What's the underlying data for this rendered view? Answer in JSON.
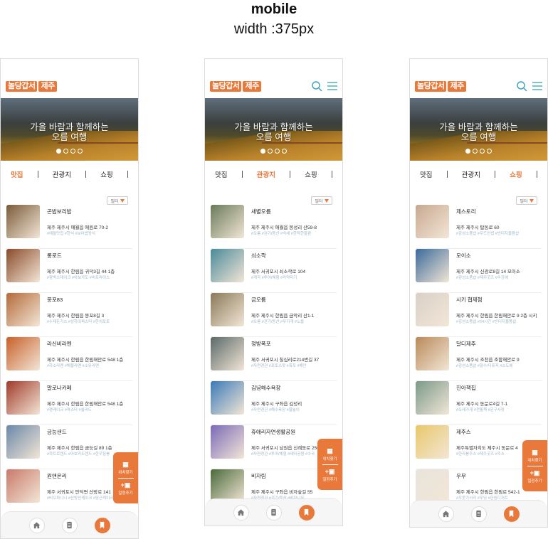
{
  "page": {
    "title": "mobile",
    "subtitle": "width :375px"
  },
  "brand": {
    "logo_part1": "놀당갑서",
    "logo_part2": "제주",
    "accent": "#e8793a",
    "tag_color": "#9ab8c8"
  },
  "hero": {
    "line1": "가을 바람과 함께하는",
    "line2": "오름 여행",
    "slides": 4,
    "active_slide": 0
  },
  "tabs": [
    "맛집",
    "관광지",
    "쇼핑"
  ],
  "filter_label": "필터",
  "float": {
    "location_label": "위치찾기",
    "schedule_label": "일정추가",
    "location_icon": "map-icon",
    "schedule_icon": "calendar-plus-icon"
  },
  "bottom_nav": [
    {
      "icon": "home-icon",
      "active": false
    },
    {
      "icon": "document-icon",
      "active": false
    },
    {
      "icon": "bookmark-icon",
      "active": true
    }
  ],
  "screens": [
    {
      "active_tab": 0,
      "show_header_icons": false,
      "items": [
        {
          "name": "곤밥보리밥",
          "addr": "제주 제주시 애월읍 애원로 70-2",
          "tags": "#애월맛집 #한식 #보리밥정식",
          "thumb": "#7a5b3a"
        },
        {
          "name": "롱로드",
          "addr": "제주 제주시 한림읍 귀덕3길 44 1층",
          "tags": "#함박스테이크 #아보카도 #비프라이스",
          "thumb": "#8a4a2a"
        },
        {
          "name": "몽포83",
          "addr": "제주 제주시 한림읍 몽포8길 3",
          "tags": "#수제돈가스 #상하이파스타 #한치포토",
          "thumb": "#b46a3a"
        },
        {
          "name": "라신비라멘",
          "addr": "제주 제주시 한림읍 한림해안로 548 1층",
          "tags": "#하소라멘 #해물라멘 #소유라멘",
          "thumb": "#c8602a"
        },
        {
          "name": "말로나카페",
          "addr": "제주 제주시 한림읍 한림해안로 548 1층",
          "tags": "#팬케이크 #파스타 #샐러드",
          "thumb": "#a03a2a"
        },
        {
          "name": "금능샌드",
          "addr": "제주 제주시 한림읍 금능길 89 1층",
          "tags": "#하트로렌드 #아보카도렌드 #한우잠봉",
          "thumb": "#6a88a8"
        },
        {
          "name": "원앤온리",
          "addr": "제주 서귀포시 안덕면 산방로 141",
          "tags": "#비프파니니 #산방산케이크 #당근케이크",
          "thumb": "#c87a6a"
        }
      ]
    },
    {
      "active_tab": 1,
      "show_header_icons": true,
      "items": [
        {
          "name": "새별오름",
          "addr": "제주 제주시 애월읍 봉성리 산59-8",
          "tags": "#오름 #걷기/등산 #억새 #한적한들판",
          "thumb": "#6a7a5a"
        },
        {
          "name": "쇠소깍",
          "addr": "제주 서귀포시 쇠소깍로 104",
          "tags": "#계곡 #투어/체험 #카약타기",
          "thumb": "#4a8a9a"
        },
        {
          "name": "금오름",
          "addr": "제주 제주시 한림읍 금악리 산1-1",
          "tags": "#오름 #걷기/등산 #무지개 #노을",
          "thumb": "#8a7a5a"
        },
        {
          "name": "정방폭포",
          "addr": "제주 서귀포시 칠십리로214번길 37",
          "tags": "#자연경관 #포토스팟 #폭포 #해안",
          "thumb": "#5a6a6a"
        },
        {
          "name": "김녕해수욕장",
          "addr": "제주 제주시 구좌읍 김녕리",
          "tags": "#자연경관 #해수욕장 #물놀이",
          "thumb": "#3a7ab8"
        },
        {
          "name": "휴애리자연생활공원",
          "addr": "제주 서귀포시 남원읍 신례동로 256",
          "tags": "#자연경관 #투어/체험 #테마공원 #수국",
          "thumb": "#7a6ab8"
        },
        {
          "name": "비자림",
          "addr": "제주 제주시 구좌읍 비자숲길 55",
          "tags": "#자연경관 #걷기/등산 #비자나무",
          "thumb": "#4a6a3a"
        }
      ]
    },
    {
      "active_tab": 2,
      "show_header_icons": true,
      "items": [
        {
          "name": "제스토리",
          "addr": "제주 제주시 탑동로 60",
          "tags": "#감성소품샵 #우드컨셉 #빈티지물품샵",
          "thumb": "#c8a890"
        },
        {
          "name": "모이소",
          "addr": "제주 제주시 신광로8길 14 모이소",
          "tags": "#감성소품샵 #제주굿즈 #수공예",
          "thumb": "#3a6a9a"
        },
        {
          "name": "시키 협제점",
          "addr": "제주 제주시 한림읍 한림해안로 9 2층 시키",
          "tags": "#감성소품샵 #24시간 #빈티지물품샵",
          "thumb": "#d8d0c8"
        },
        {
          "name": "달디제주",
          "addr": "제주 제주시 조천읍 조함해안로 9",
          "tags": "#감성소품샵 #향수/디퓨저 #소도에",
          "thumb": "#b88a5a"
        },
        {
          "name": "진아책집",
          "addr": "제주 제주시 동문로4길 7-1",
          "tags": "#오래가게 #전통책 #문구사랑",
          "thumb": "#7a9a8a"
        },
        {
          "name": "제주스",
          "addr": "제주특별자치도 제주시 동문로 4",
          "tags": "#한라봉주스 #제주굿즈 #주스",
          "thumb": "#e8c86a"
        },
        {
          "name": "우무",
          "addr": "제주 제주시 한림읍 한림로 542-1",
          "tags": "#우뭇가사리 #푸딩 #한림디저트",
          "thumb": "#e8e4dc"
        }
      ]
    }
  ]
}
